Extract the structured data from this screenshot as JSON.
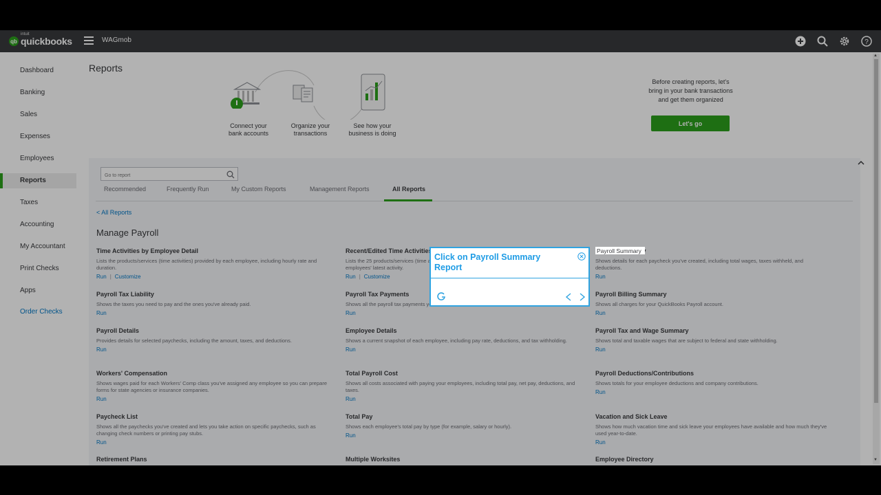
{
  "topbar": {
    "brand": "quickbooks",
    "intuit": "intuit",
    "company": "WAGmob"
  },
  "sidebar": {
    "items": [
      {
        "label": "Dashboard"
      },
      {
        "label": "Banking"
      },
      {
        "label": "Sales"
      },
      {
        "label": "Expenses"
      },
      {
        "label": "Employees"
      },
      {
        "label": "Reports"
      },
      {
        "label": "Taxes"
      },
      {
        "label": "Accounting"
      },
      {
        "label": "My Accountant"
      },
      {
        "label": "Print Checks"
      },
      {
        "label": "Apps"
      },
      {
        "label": "Order Checks"
      }
    ]
  },
  "main": {
    "title": "Reports",
    "hero": {
      "step1": "Connect your bank accounts",
      "step2": "Organize your transactions",
      "step3": "See how your business is doing",
      "message": "Before creating reports, let's bring in your bank transactions and get them organized",
      "cta": "Let's go"
    },
    "search": {
      "placeholder": "Go to report"
    },
    "tabs": [
      {
        "label": "Recommended"
      },
      {
        "label": "Frequently Run"
      },
      {
        "label": "My Custom Reports"
      },
      {
        "label": "Management Reports"
      },
      {
        "label": "All Reports"
      }
    ],
    "breadcrumb": "< All Reports",
    "section_title": "Manage Payroll",
    "run_label": "Run",
    "customize_label": "Customize",
    "reports": [
      {
        "title": "Time Activities by Employee Detail",
        "desc": "Lists the products/services (time activities) provided by each employee, including hourly rate and duration."
      },
      {
        "title": "Recent/Edited Time Activities",
        "desc": "Lists the 25 products/services (time activities) most recently added or edited so you can see your employees' latest activity."
      },
      {
        "title": "Payroll Summary",
        "desc": "Shows details for each paycheck you've created, including total wages, taxes withheld, and deductions."
      },
      {
        "title": "Payroll Tax Liability",
        "desc": "Shows the taxes you need to pay and the ones you've already paid."
      },
      {
        "title": "Payroll Tax Payments",
        "desc": "Shows all the payroll tax payments you've made."
      },
      {
        "title": "Payroll Billing Summary",
        "desc": "Shows all charges for your QuickBooks Payroll account."
      },
      {
        "title": "Payroll Details",
        "desc": "Provides details for selected paychecks, including the amount, taxes, and deductions."
      },
      {
        "title": "Employee Details",
        "desc": "Shows a current snapshot of each employee, including pay rate, deductions, and tax withholding."
      },
      {
        "title": "Payroll Tax and Wage Summary",
        "desc": "Shows total and taxable wages that are subject to federal and state withholding."
      },
      {
        "title": "Workers' Compensation",
        "desc": "Shows wages paid for each Workers' Comp class you've assigned any employee so you can prepare forms for state agencies or insurance companies."
      },
      {
        "title": "Total Payroll Cost",
        "desc": "Shows all costs associated with paying your employees, including total pay, net pay, deductions, and taxes."
      },
      {
        "title": "Payroll Deductions/Contributions",
        "desc": "Shows totals for your employee deductions and company contributions."
      },
      {
        "title": "Paycheck List",
        "desc": "Shows all the paychecks you've created and lets you take action on specific paychecks, such as changing check numbers or printing pay stubs."
      },
      {
        "title": "Total Pay",
        "desc": "Shows each employee's total pay by type (for example, salary or hourly)."
      },
      {
        "title": "Vacation and Sick Leave",
        "desc": "Shows how much vacation time and sick leave your employees have available and how much they've used year-to-date."
      },
      {
        "title": "Retirement Plans",
        "desc": ""
      },
      {
        "title": "Multiple Worksites",
        "desc": ""
      },
      {
        "title": "Employee Directory",
        "desc": ""
      }
    ]
  },
  "tooltip": {
    "title": "Click on Payroll Summary Report",
    "highlight_label": "Payroll Summary"
  },
  "colors": {
    "brand_green": "#2ca01c",
    "link_blue": "#0077c5",
    "tooltip_blue": "#2fa3e0"
  }
}
